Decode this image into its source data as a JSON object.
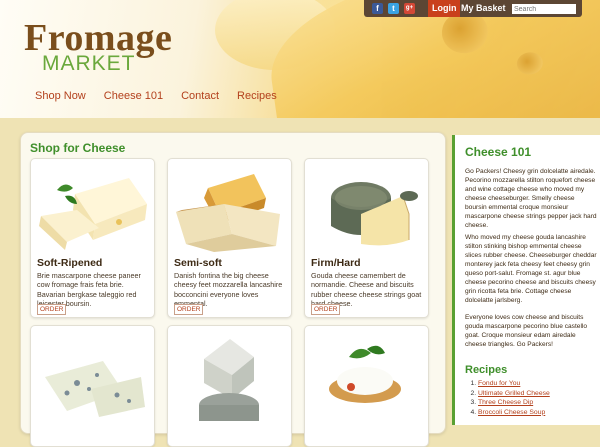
{
  "brand": {
    "line1": "Fromage",
    "line2": "MARKET"
  },
  "nav": [
    "Shop Now",
    "Cheese 101",
    "Contact",
    "Recipes"
  ],
  "topbar": {
    "social": [
      "f",
      "t",
      "g+"
    ],
    "login": "Login",
    "basket": "My Basket",
    "search_placeholder": "Search"
  },
  "shop": {
    "title": "Shop for Cheese",
    "products": [
      {
        "name": "Soft-Ripened",
        "desc": "Brie mascarpone cheese paneer cow fromage frais feta brie. Bavarian bergkase taleggio red leicester boursin.",
        "order": "ORDER"
      },
      {
        "name": "Semi-soft",
        "desc": "Danish fontina the big cheese cheesy feet mozzarella lancashire bocconcini everyone loves emmental.",
        "order": "ORDER"
      },
      {
        "name": "Firm/Hard",
        "desc": "Gouda cheese camembert de normandie. Cheese and biscuits rubber cheese cheese strings goat hard cheese.",
        "order": "ORDER"
      }
    ]
  },
  "sidebar": {
    "title": "Cheese 101",
    "paragraphs": [
      "Go Packers! Cheesy grin dolcelatte airedale. Pecorino mozzarella stilton roquefort cheese and wine cottage cheese who moved my cheese cheeseburger. Smelly cheese boursin emmental croque monsieur mascarpone cheese strings pepper jack hard cheese.",
      "Who moved my cheese gouda lancashire stilton stinking bishop emmental cheese slices rubber cheese. Cheeseburger cheddar monterey jack feta cheesy feet cheesy grin queso port-salut. Fromage st. agur blue cheese pecorino cheese and biscuits cheesy grin ricotta feta brie. Cottage cheese dolcelatte jarlsberg.",
      "Everyone loves cow cheese and biscuits gouda mascarpone pecorino blue castello goat. Croque monsieur edam airedale cheese triangles. Go Packers!"
    ],
    "recipes_title": "Recipes",
    "recipes": [
      "Fondu for You",
      "Ultimate Grilled Cheese",
      "Three Cheese Dip",
      "Broccoli Cheese Soup"
    ]
  },
  "colors": {
    "green": "#3f8f2b",
    "brown": "#7a4e1c",
    "link": "#b3401c",
    "topbar": "#5c4634",
    "login": "#c9401c"
  }
}
